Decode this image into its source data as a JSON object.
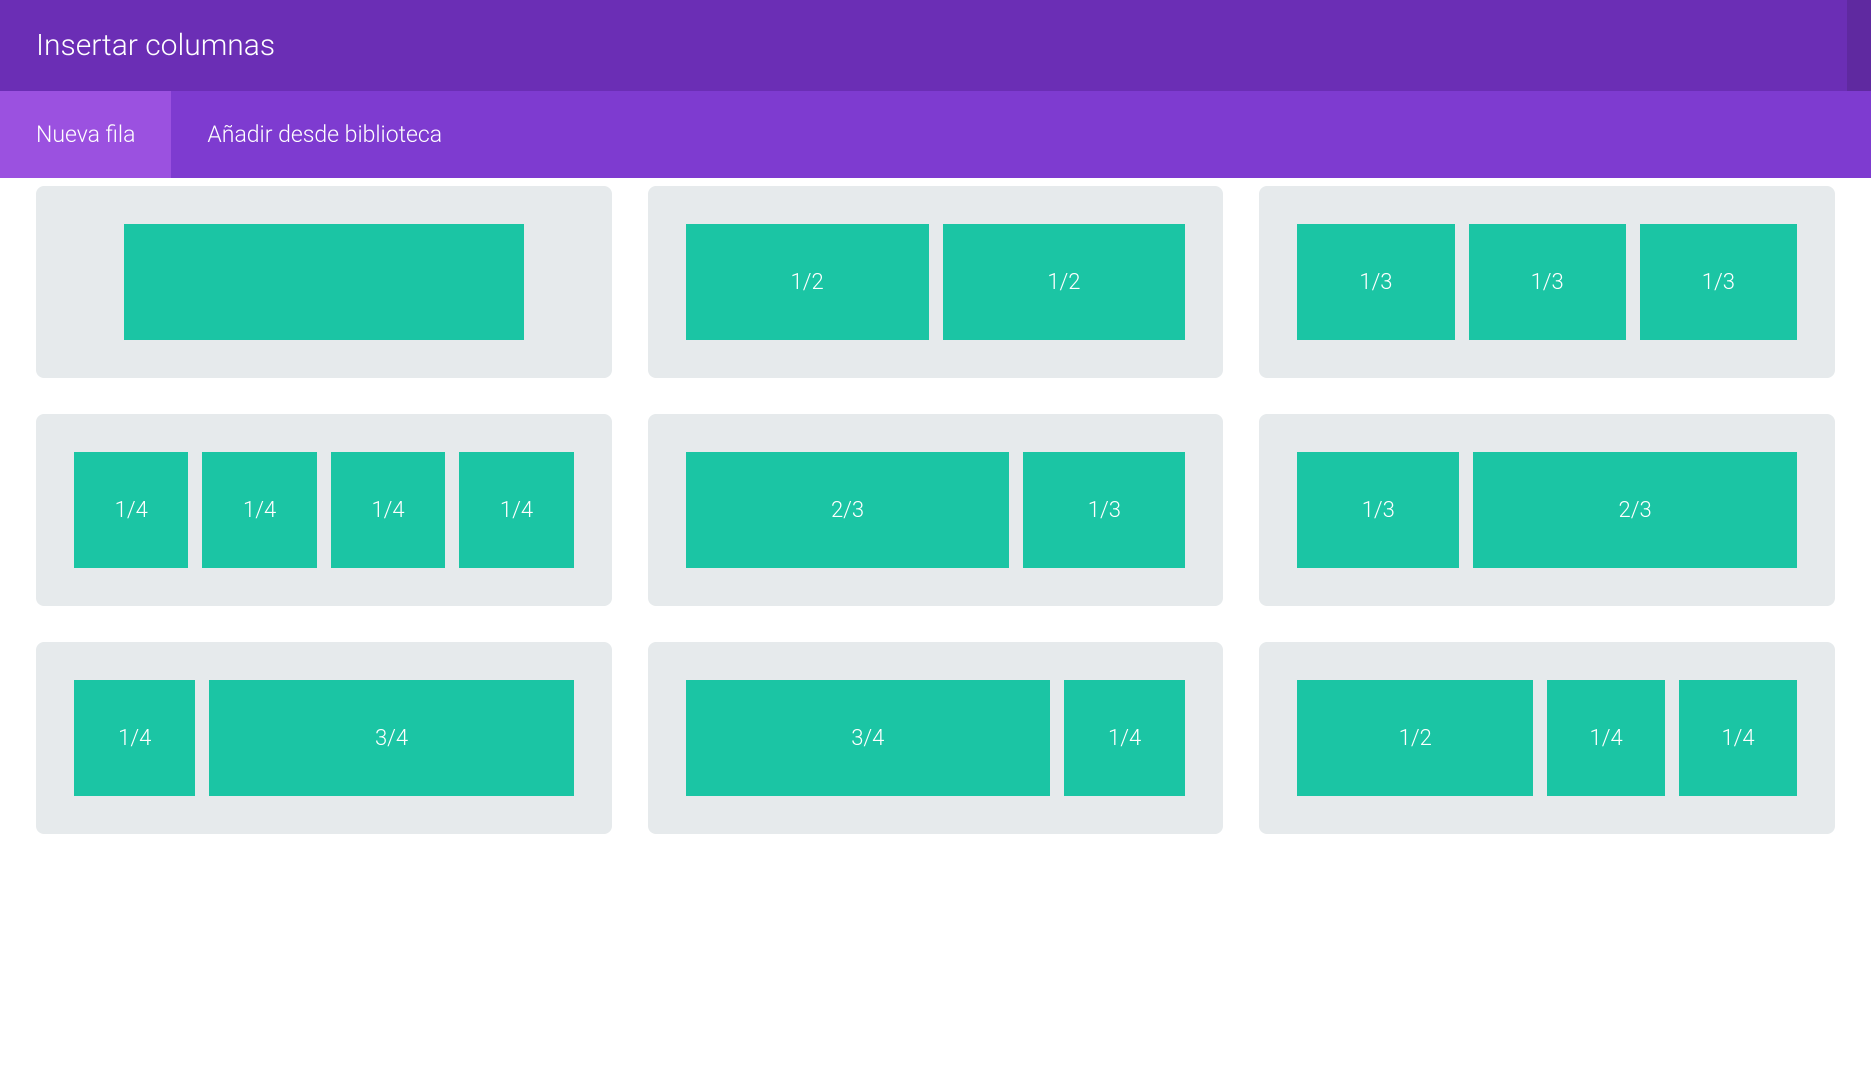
{
  "header": {
    "title": "Insertar columnas"
  },
  "tabs": {
    "new_row": "Nueva fila",
    "add_from_library": "Añadir desde biblioteca"
  },
  "layouts": [
    {
      "id": "full",
      "cols": [
        {
          "label": "",
          "width": "full-center"
        }
      ]
    },
    {
      "id": "half-half",
      "cols": [
        {
          "label": "1/2",
          "width": "1"
        },
        {
          "label": "1/2",
          "width": "1"
        }
      ]
    },
    {
      "id": "thirds",
      "cols": [
        {
          "label": "1/3",
          "width": "1"
        },
        {
          "label": "1/3",
          "width": "1"
        },
        {
          "label": "1/3",
          "width": "1"
        }
      ]
    },
    {
      "id": "quarters",
      "cols": [
        {
          "label": "1/4",
          "width": "1"
        },
        {
          "label": "1/4",
          "width": "1"
        },
        {
          "label": "1/4",
          "width": "1"
        },
        {
          "label": "1/4",
          "width": "1"
        }
      ]
    },
    {
      "id": "two-thirds-one-third",
      "cols": [
        {
          "label": "2/3",
          "width": "2"
        },
        {
          "label": "1/3",
          "width": "1"
        }
      ]
    },
    {
      "id": "one-third-two-thirds",
      "cols": [
        {
          "label": "1/3",
          "width": "1"
        },
        {
          "label": "2/3",
          "width": "2"
        }
      ]
    },
    {
      "id": "one-quarter-three-quarters",
      "cols": [
        {
          "label": "1/4",
          "width": "1"
        },
        {
          "label": "3/4",
          "width": "3"
        }
      ]
    },
    {
      "id": "three-quarters-one-quarter",
      "cols": [
        {
          "label": "3/4",
          "width": "3"
        },
        {
          "label": "1/4",
          "width": "1"
        }
      ]
    },
    {
      "id": "half-quarter-quarter",
      "cols": [
        {
          "label": "1/2",
          "width": "2"
        },
        {
          "label": "1/4",
          "width": "1"
        },
        {
          "label": "1/4",
          "width": "1"
        }
      ]
    }
  ]
}
